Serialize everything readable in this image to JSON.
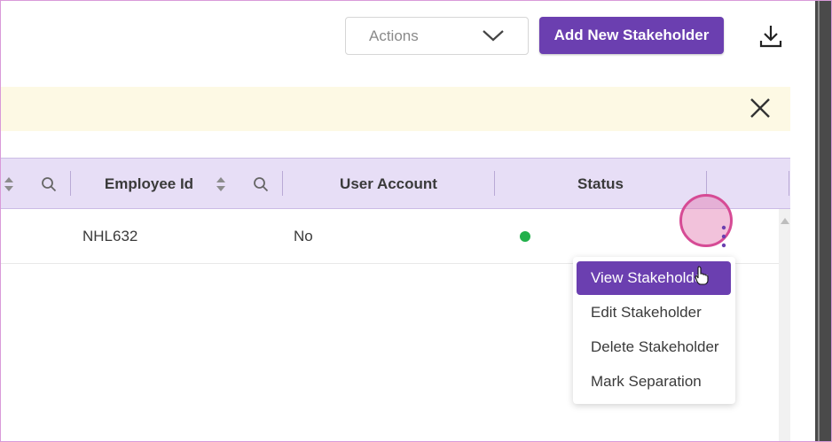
{
  "toolbar": {
    "actions_placeholder": "Actions",
    "add_button_label": "Add New Stakeholder"
  },
  "table": {
    "columns": [
      "Employee Id",
      "User Account",
      "Status"
    ],
    "rows": [
      {
        "employee_id": "NHL632",
        "user_account": "No",
        "status": "active"
      }
    ]
  },
  "row_menu": {
    "items": [
      "View Stakeholder",
      "Edit Stakeholder",
      "Delete Stakeholder",
      "Mark Separation"
    ],
    "highlighted_index": 0
  },
  "colors": {
    "accent": "#6b3fb0",
    "header_bg": "#e7def6",
    "banner_bg": "#fdf9e4",
    "status_active": "#22b04b"
  }
}
